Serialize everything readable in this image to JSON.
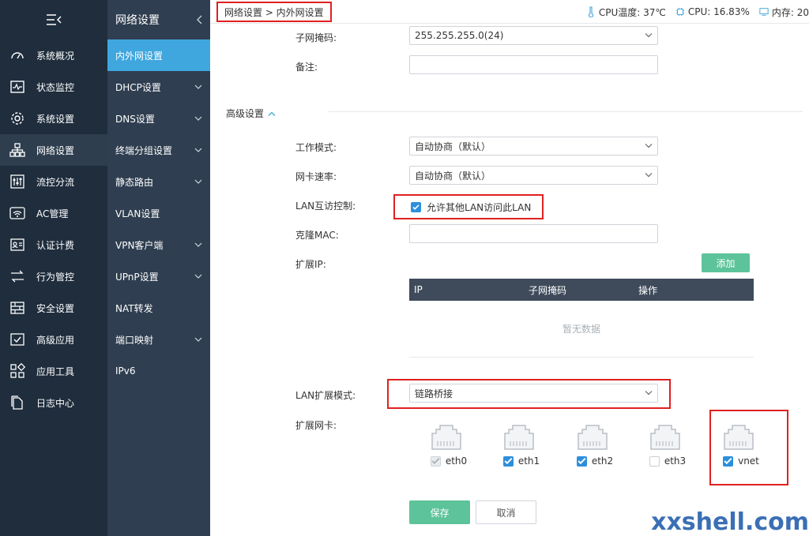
{
  "sidebar": {
    "items": [
      {
        "label": "系统概况",
        "icon": "dashboard-icon"
      },
      {
        "label": "状态监控",
        "icon": "monitor-icon"
      },
      {
        "label": "系统设置",
        "icon": "gear-icon"
      },
      {
        "label": "网络设置",
        "icon": "network-icon"
      },
      {
        "label": "流控分流",
        "icon": "sliders-icon"
      },
      {
        "label": "AC管理",
        "icon": "wifi-icon"
      },
      {
        "label": "认证计费",
        "icon": "id-card-icon"
      },
      {
        "label": "行为管控",
        "icon": "arrows-icon"
      },
      {
        "label": "安全设置",
        "icon": "firewall-icon"
      },
      {
        "label": "高级应用",
        "icon": "check-box-icon"
      },
      {
        "label": "应用工具",
        "icon": "grid-icon"
      },
      {
        "label": "日志中心",
        "icon": "document-icon"
      }
    ]
  },
  "subnav": {
    "title": "网络设置",
    "items": [
      {
        "label": "内外网设置"
      },
      {
        "label": "DHCP设置"
      },
      {
        "label": "DNS设置"
      },
      {
        "label": "终端分组设置"
      },
      {
        "label": "静态路由"
      },
      {
        "label": "VLAN设置"
      },
      {
        "label": "VPN客户端"
      },
      {
        "label": "UPnP设置"
      },
      {
        "label": "NAT转发"
      },
      {
        "label": "端口映射"
      },
      {
        "label": "IPv6"
      }
    ]
  },
  "topbar": {
    "breadcrumb": "网络设置 > 内外网设置",
    "cpu_temp": "CPU温度: 37℃",
    "cpu_usage": "CPU: 16.83%",
    "memory": "内存: 20"
  },
  "form": {
    "subnet_label": "子网掩码:",
    "subnet_value": "255.255.255.0(24)",
    "remark_label": "备注:",
    "remark_value": "",
    "advanced_label": "高级设置",
    "work_mode_label": "工作模式:",
    "work_mode_value": "自动协商（默认）",
    "nic_speed_label": "网卡速率:",
    "nic_speed_value": "自动协商（默认）",
    "lan_access_label": "LAN互访控制:",
    "lan_access_check": "允许其他LAN访问此LAN",
    "clone_mac_label": "克隆MAC:",
    "clone_mac_value": "",
    "ext_ip_label": "扩展IP:",
    "add_button": "添加",
    "table": {
      "headers": [
        "IP",
        "子网掩码",
        "操作"
      ],
      "empty": "暂无数据"
    },
    "lan_ext_mode_label": "LAN扩展模式:",
    "lan_ext_mode_value": "链路桥接",
    "ext_nic_label": "扩展网卡:",
    "nics": [
      {
        "name": "eth0",
        "checked": true,
        "disabled": true
      },
      {
        "name": "eth1",
        "checked": true,
        "disabled": false
      },
      {
        "name": "eth2",
        "checked": true,
        "disabled": false
      },
      {
        "name": "eth3",
        "checked": false,
        "disabled": false
      },
      {
        "name": "vnet",
        "checked": true,
        "disabled": false
      }
    ],
    "save_button": "保存",
    "cancel_button": "取消"
  },
  "watermark": "xxshell.com",
  "colors": {
    "sidebar_bg": "#1f2d3d",
    "subnav_bg": "#2f3e50",
    "accent_blue": "#3fa6de",
    "green_button": "#5cc39a",
    "highlight_red": "#e02020"
  }
}
